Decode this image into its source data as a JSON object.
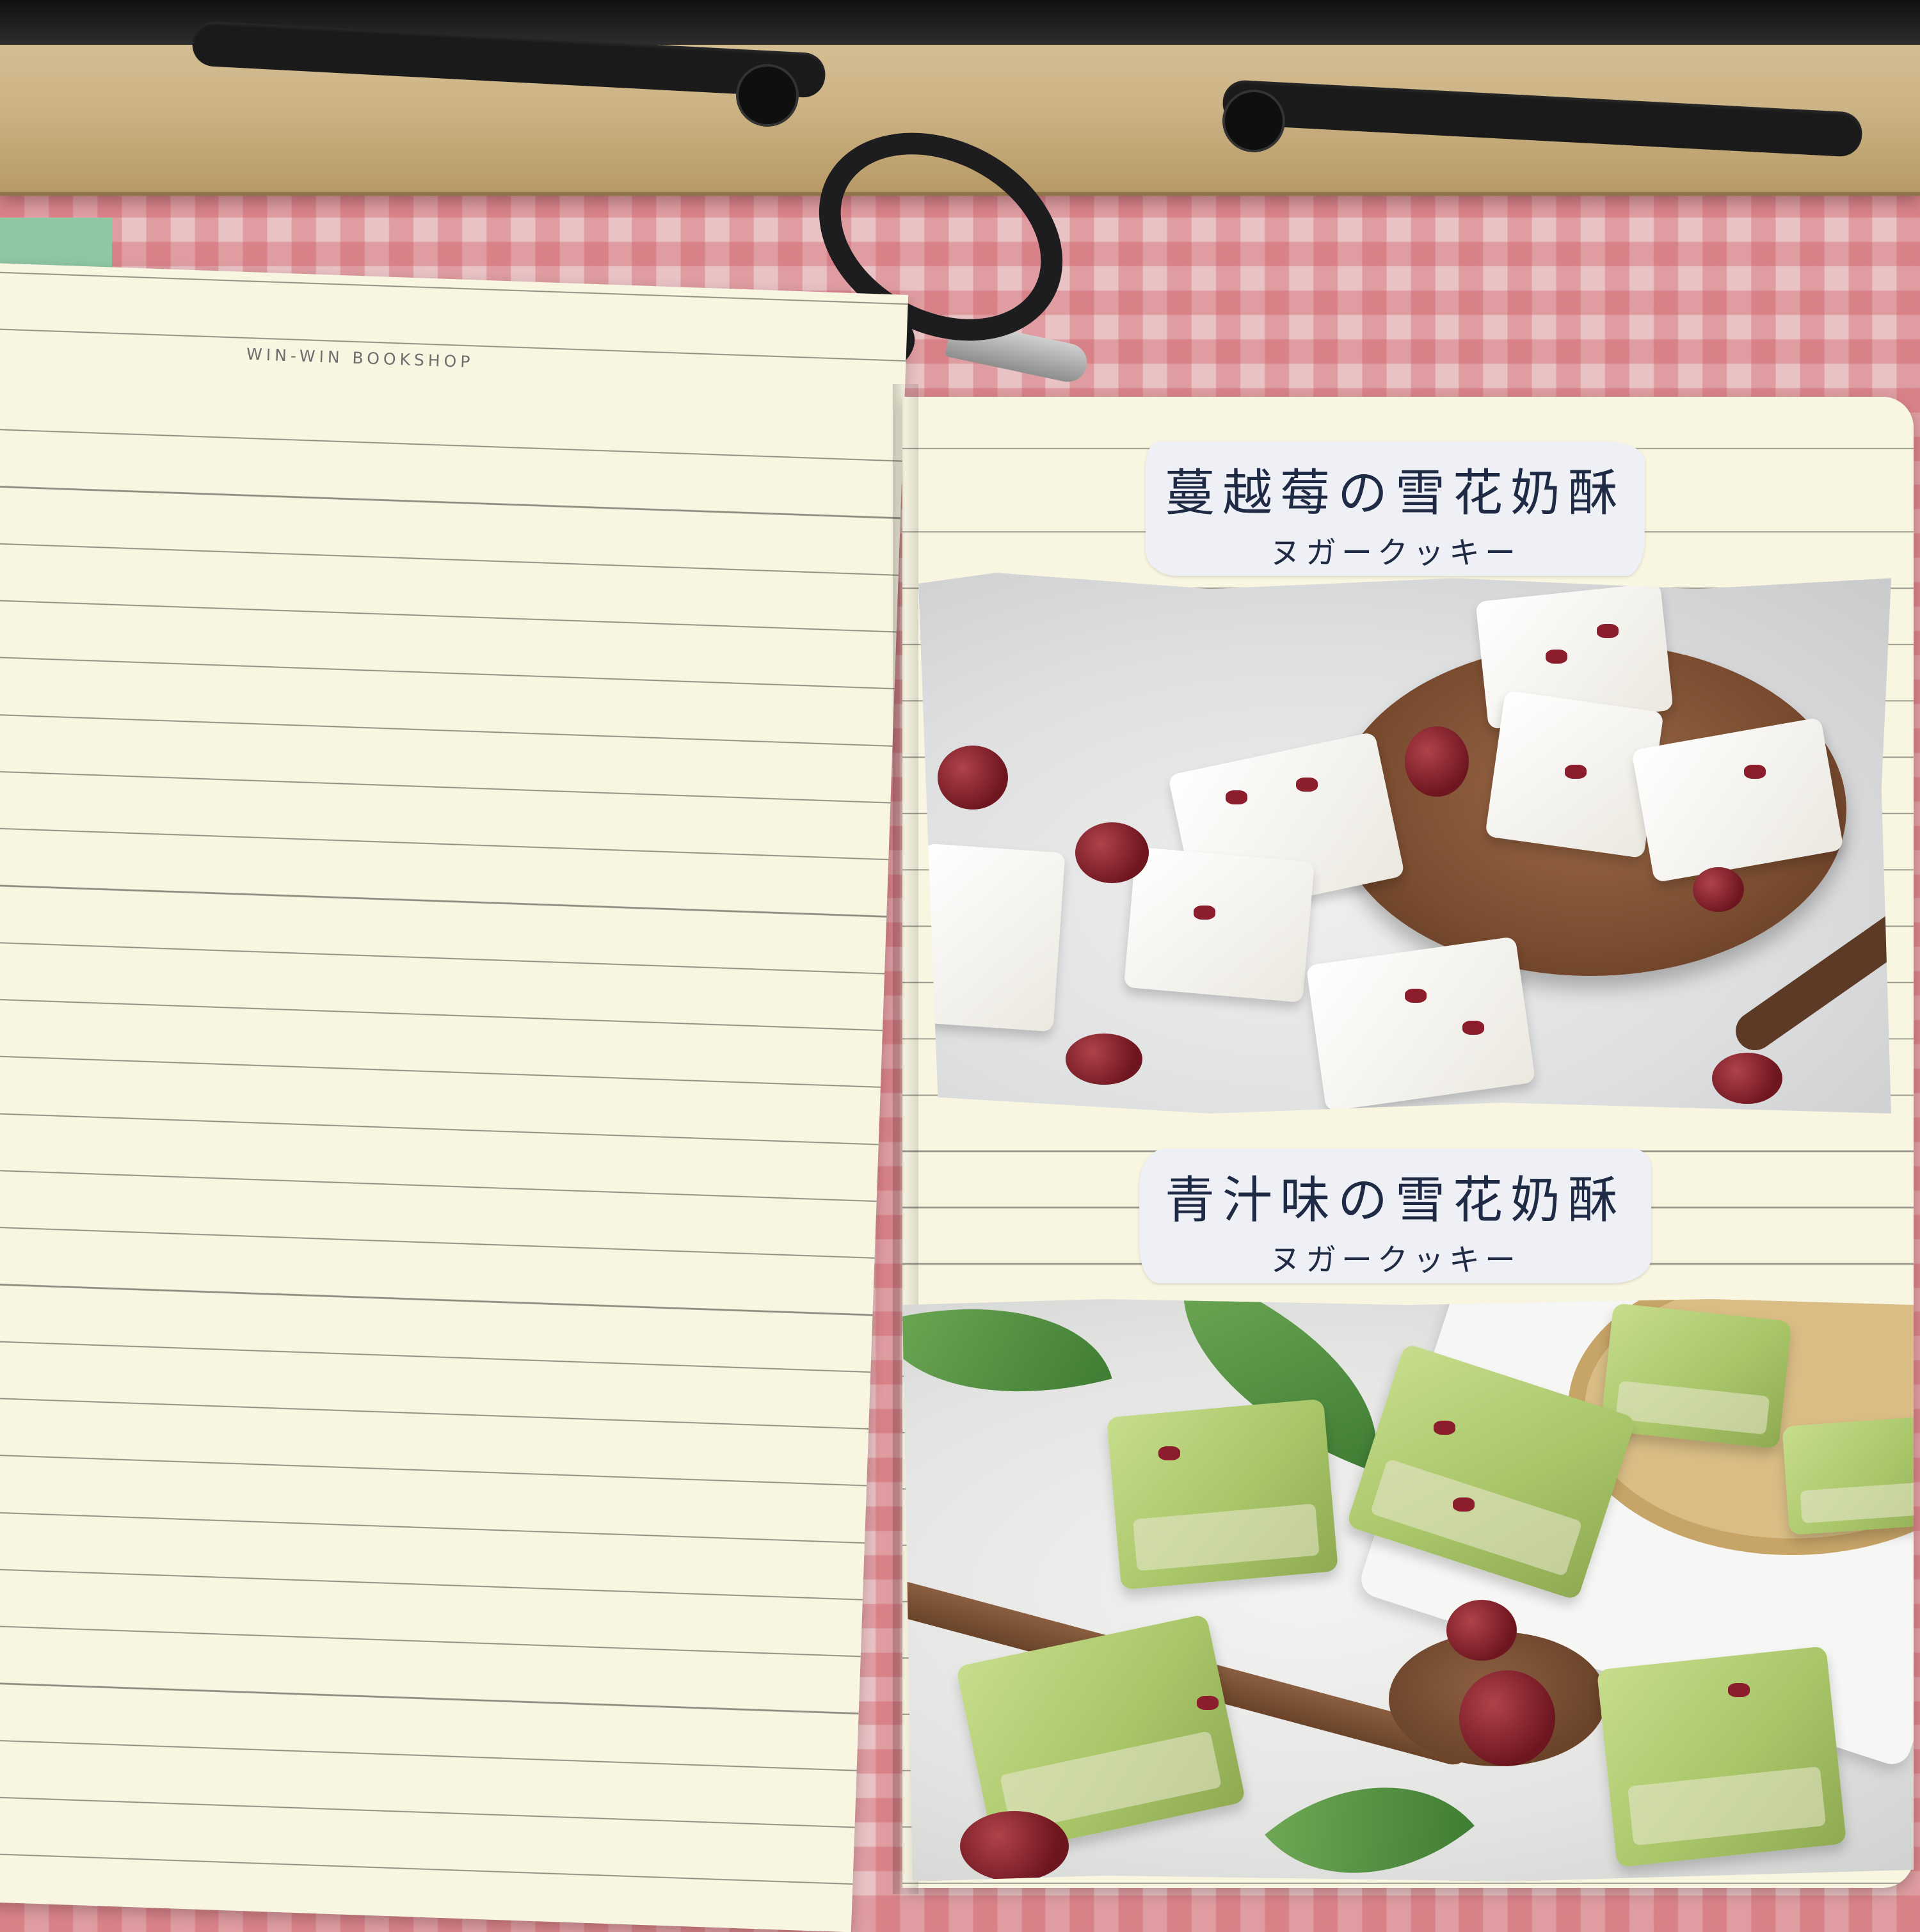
{
  "notebook": {
    "brand": "WIN-WIN BOOKSHOP"
  },
  "labels": [
    {
      "chinese": "蔓越莓の雪花奶酥",
      "japanese": "ヌガークッキー"
    },
    {
      "chinese": "青汁味の雪花奶酥",
      "japanese": "ヌガークッキー"
    }
  ]
}
